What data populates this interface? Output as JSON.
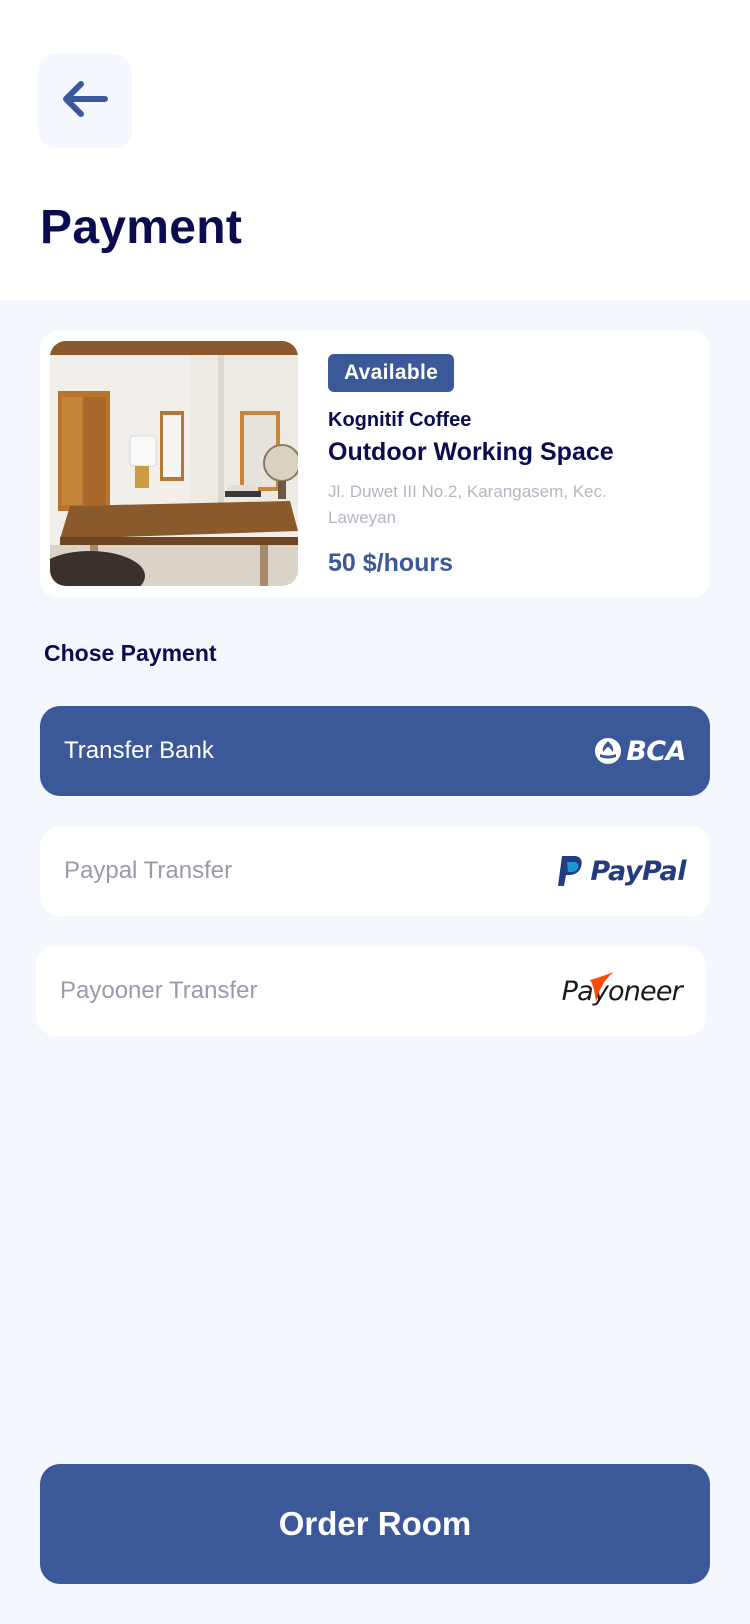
{
  "page": {
    "title": "Payment"
  },
  "back_button": {
    "icon": "arrow-left-icon"
  },
  "room_card": {
    "badge": "Available",
    "cafe_name": "Kognitif Coffee",
    "space_name": "Outdoor Working Space",
    "address": "Jl. Duwet III No.2, Karangasem, Kec. Laweyan",
    "price": "50 $/hours",
    "image": "room-photo"
  },
  "payment": {
    "section_label": "Chose Payment",
    "options": [
      {
        "label": "Transfer Bank",
        "logo": "BCA",
        "selected": true
      },
      {
        "label": "Paypal Transfer",
        "logo": "PayPal",
        "selected": false
      },
      {
        "label": "Payooner Transfer",
        "logo": "Payoneer",
        "selected": false
      }
    ]
  },
  "footer": {
    "order_label": "Order Room"
  },
  "colors": {
    "primary": "#3B5998",
    "title": "#0B0B4F",
    "background": "#F4F7FE",
    "muted": "#9A9AAA"
  }
}
